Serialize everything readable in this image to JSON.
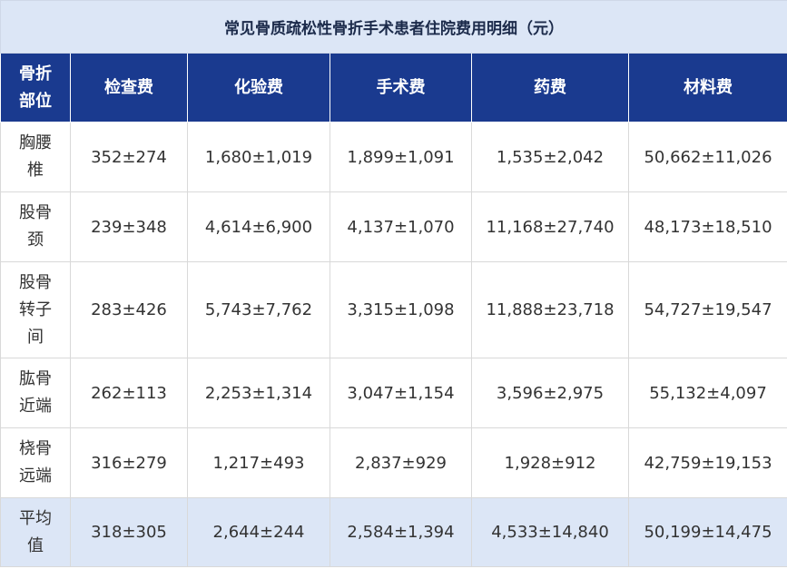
{
  "title": "常见骨质疏松性骨折手术患者住院费用明细（元）",
  "headers": {
    "site": [
      "骨折",
      "部位"
    ],
    "exam": "检查费",
    "lab": "化验费",
    "surgery": "手术费",
    "drug": "药费",
    "material": "材料费"
  },
  "rows": [
    {
      "site": [
        "胸腰",
        "椎"
      ],
      "exam": "352±274",
      "lab": "1,680±1,019",
      "surgery": "1,899±1,091",
      "drug": "1,535±2,042",
      "material": "50,662±11,026"
    },
    {
      "site": [
        "股骨",
        "颈"
      ],
      "exam": "239±348",
      "lab": "4,614±6,900",
      "surgery": "4,137±1,070",
      "drug": "11,168±27,740",
      "material": "48,173±18,510"
    },
    {
      "site": [
        "股骨",
        "转子",
        "间"
      ],
      "exam": "283±426",
      "lab": "5,743±7,762",
      "surgery": "3,315±1,098",
      "drug": "11,888±23,718",
      "material": "54,727±19,547"
    },
    {
      "site": [
        "肱骨",
        "近端"
      ],
      "exam": "262±113",
      "lab": "2,253±1,314",
      "surgery": "3,047±1,154",
      "drug": "3,596±2,975",
      "material": "55,132±4,097"
    },
    {
      "site": [
        "桡骨",
        "远端"
      ],
      "exam": "316±279",
      "lab": "1,217±493",
      "surgery": "2,837±929",
      "drug": "1,928±912",
      "material": "42,759±19,153"
    },
    {
      "site": [
        "平均",
        "值"
      ],
      "exam": "318±305",
      "lab": "2,644±244",
      "surgery": "2,584±1,394",
      "drug": "4,533±14,840",
      "material": "50,199±14,475"
    }
  ],
  "colors": {
    "title_bg": "#dce6f6",
    "header_bg": "#1a3a8f",
    "header_text": "#ffffff",
    "avg_row_bg": "#dce6f6"
  }
}
